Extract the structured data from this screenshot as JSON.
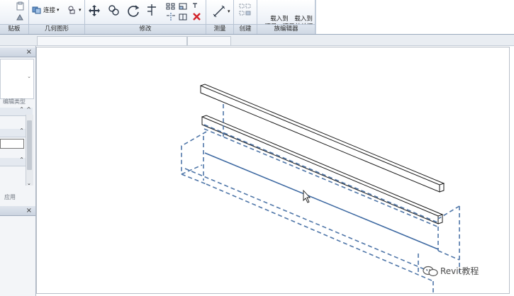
{
  "ribbon": {
    "panels": [
      {
        "title": "贴板"
      },
      {
        "title": "几何图形"
      },
      {
        "title": "修改"
      },
      {
        "title": "测量"
      },
      {
        "title": "创建"
      },
      {
        "title": "族编辑器"
      }
    ],
    "tools": {
      "join": "连接",
      "load_into_project": "载入到\n项目",
      "load_into_project_close": "载入到\n项目并关闭"
    }
  },
  "palette": {
    "top_close": "×",
    "edit_type": "编辑类型",
    "apply": "应用",
    "bottom_close": "×"
  },
  "watermark": {
    "text": "Revit教程"
  },
  "colors": {
    "selection_blue": "#4f76a8",
    "model_black": "#1a1a1a",
    "ribbon_bg": "#eef2f8"
  }
}
